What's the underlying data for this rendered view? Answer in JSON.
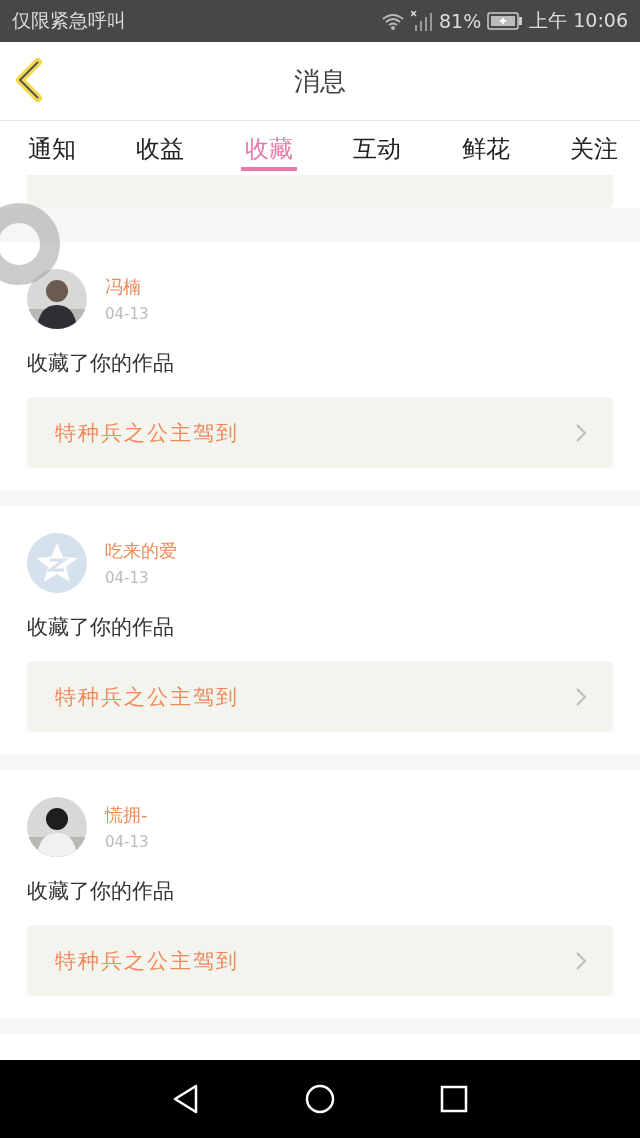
{
  "status_bar": {
    "notice": "仅限紧急呼叫",
    "battery": "81%",
    "time": "上午 10:06"
  },
  "header": {
    "title": "消息"
  },
  "tabs": [
    {
      "label": "通知",
      "selected": false
    },
    {
      "label": "收益",
      "selected": false
    },
    {
      "label": "收藏",
      "selected": true
    },
    {
      "label": "互动",
      "selected": false
    },
    {
      "label": "鲜花",
      "selected": false
    },
    {
      "label": "关注",
      "selected": false
    }
  ],
  "messages": [
    {
      "name": "冯楠",
      "date": "04-13",
      "text": "收藏了你的作品",
      "work": "特种兵之公主驾到"
    },
    {
      "avatar": {
        "kind": "default"
      },
      "name": "吃来的爱",
      "date": "04-13",
      "text": "收藏了你的作品",
      "work": "特种兵之公主驾到"
    },
    {
      "name": "慌拥-",
      "date": "04-13",
      "text": "收藏了你的作品",
      "work": "特种兵之公主驾到"
    }
  ]
}
